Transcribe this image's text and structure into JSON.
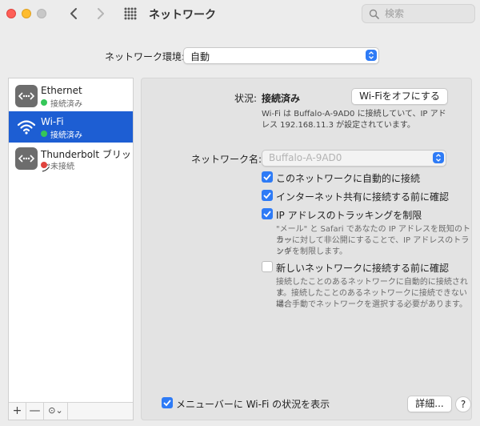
{
  "window": {
    "title": "ネットワーク",
    "search_placeholder": "検索"
  },
  "location": {
    "label": "ネットワーク環境:",
    "value": "自動"
  },
  "services": [
    {
      "name": "Ethernet",
      "status": "接続済み",
      "status_color": "#35c759",
      "icon": "ethernet-icon"
    },
    {
      "name": "Wi-Fi",
      "status": "接続済み",
      "status_color": "#35c759",
      "icon": "wifi-icon"
    },
    {
      "name": "Thunderbolt ブリッジ",
      "status": "未接続",
      "status_color": "#e0443e",
      "icon": "thunderbolt-bridge-icon"
    }
  ],
  "sidebar_tools": {
    "add": "+",
    "remove": "—",
    "action": "⊙⌄"
  },
  "detail": {
    "status_label": "状況:",
    "status_value": "接続済み",
    "toggle_button": "Wi-Fiをオフにする",
    "status_desc_1": "Wi-Fi は Buffalo-A-9AD0 に接続していて、IP アド",
    "status_desc_2": "レス 192.168.11.3 が設定されています。",
    "network_name_label": "ネットワーク名:",
    "network_name_value": "Buffalo-A-9AD0",
    "options": [
      {
        "label": "このネットワークに自動的に接続",
        "checked": true
      },
      {
        "label": "インターネット共有に接続する前に確認",
        "checked": true
      },
      {
        "label": "IP アドレスのトラッキングを制限",
        "checked": true
      }
    ],
    "tracking_desc_1": "\"メール\" と Safari であなたの IP アドレスを既知のトラッ",
    "tracking_desc_2": "カーに対して非公開にすることで、IP アドレスのトラッキ",
    "tracking_desc_3": "ングを制限します。",
    "ask_join_label": "新しいネットワークに接続する前に確認",
    "ask_join_checked": false,
    "ask_desc_1": "接続したことのあるネットワークに自動的に接続されま",
    "ask_desc_2": "す。接続したことのあるネットワークに接続できない場合",
    "ask_desc_3": "は、手動でネットワークを選択する必要があります。",
    "menubar_label": "メニューバーに Wi-Fi の状況を表示",
    "menubar_checked": true,
    "advanced_button": "詳細...",
    "help_button": "?"
  },
  "colors": {
    "accent": "#2e7bf6",
    "selection": "#1d5ed3"
  }
}
